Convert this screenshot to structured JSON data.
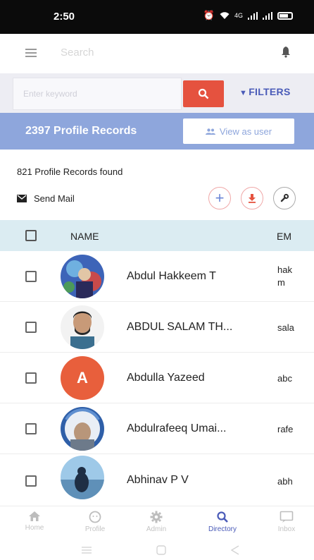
{
  "status_bar": {
    "time": "2:50",
    "network_text": "4G"
  },
  "header": {
    "search_placeholder": "Search"
  },
  "search": {
    "placeholder": "Enter keyword",
    "filters_label": "FILTERS"
  },
  "banner": {
    "total_records": "2397 Profile Records",
    "view_as_user_label": "View as user"
  },
  "results": {
    "found_text": "821 Profile Records found",
    "send_mail_label": "Send Mail"
  },
  "table": {
    "headers": {
      "name": "NAME",
      "email": "EM"
    },
    "rows": [
      {
        "name": "Abdul Hakkeem T",
        "email": "hak\nm",
        "avatar": "photo"
      },
      {
        "name": "ABDUL SALAM TH...",
        "email": "sala",
        "avatar": "photo"
      },
      {
        "name": "Abdulla Yazeed",
        "email": "abc",
        "avatar": "letter",
        "letter": "A"
      },
      {
        "name": "Abdulrafeeq Umai...",
        "email": "rafe",
        "avatar": "photo"
      },
      {
        "name": "Abhinav P V",
        "email": "abh",
        "avatar": "photo"
      }
    ]
  },
  "bottom_nav": [
    {
      "label": "Home",
      "icon": "home-icon"
    },
    {
      "label": "Profile",
      "icon": "profile-icon"
    },
    {
      "label": "Admin",
      "icon": "gear-icon"
    },
    {
      "label": "Directory",
      "icon": "search-icon",
      "active": true
    },
    {
      "label": "Inbox",
      "icon": "inbox-icon"
    }
  ],
  "colors": {
    "accent": "#4a5bb8",
    "search_button": "#e5523f",
    "banner": "#8ea6dc",
    "table_header": "#dbecf2"
  }
}
